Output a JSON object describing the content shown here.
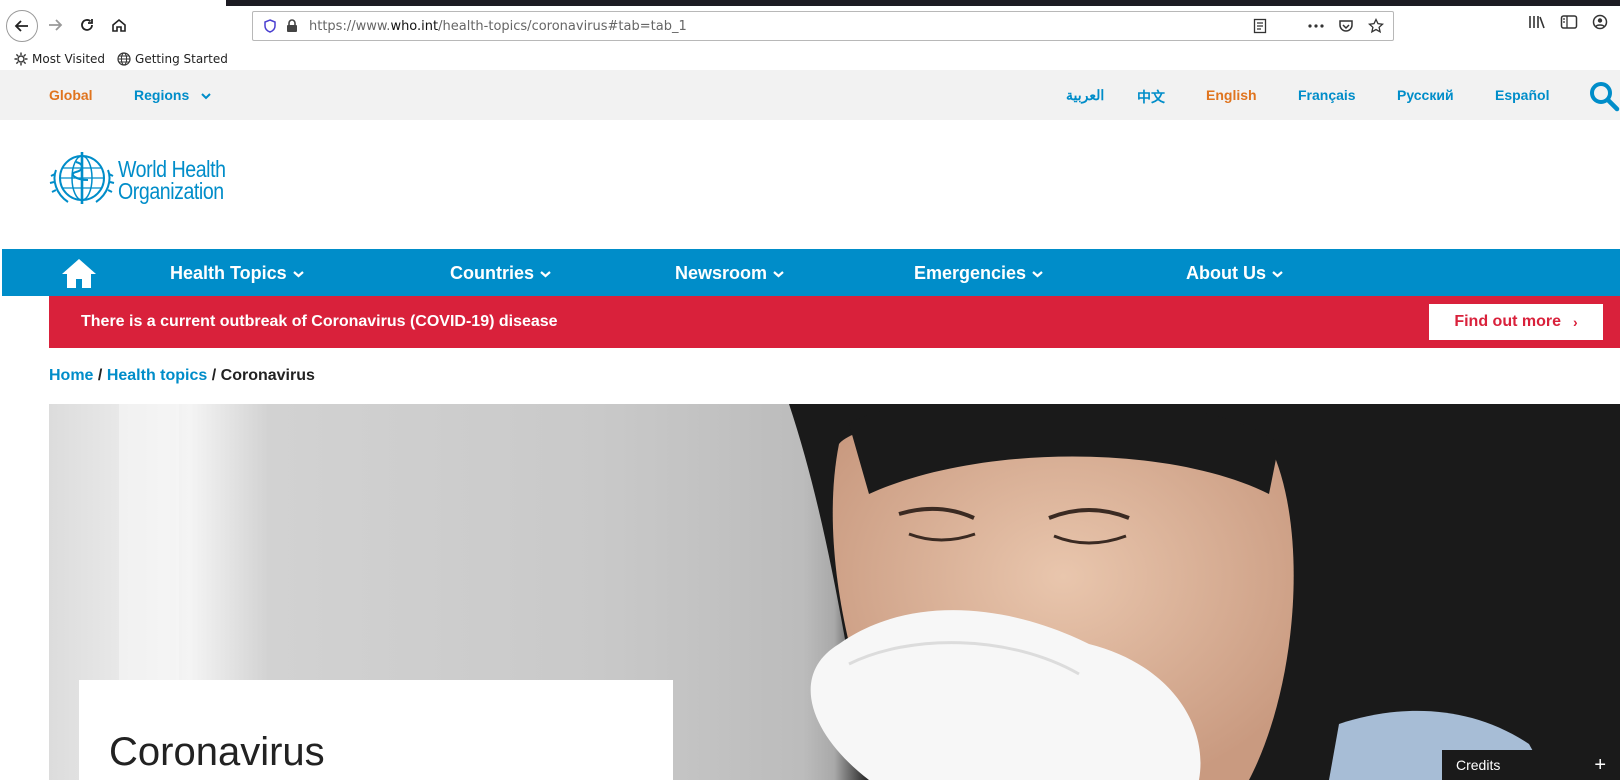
{
  "browser": {
    "url_prefix": "https://www.",
    "url_domain": "who.int",
    "url_path": "/health-topics/coronavirus#tab=tab_1",
    "bookmarks": [
      {
        "label": "Most Visited",
        "icon": "gear-icon"
      },
      {
        "label": "Getting Started",
        "icon": "globe-icon"
      }
    ]
  },
  "lang_bar": {
    "global": "Global",
    "regions": "Regions",
    "languages": [
      "العربية",
      "中文",
      "English",
      "Français",
      "Русский",
      "Español"
    ],
    "active_language": "English"
  },
  "logo": {
    "line1": "World Health",
    "line2": "Organization"
  },
  "nav": {
    "items": [
      "Health Topics",
      "Countries",
      "Newsroom",
      "Emergencies",
      "About Us"
    ]
  },
  "alert": {
    "text": "There is a current outbreak of Coronavirus (COVID-19) disease",
    "button": "Find out more",
    "button_arrow": "›"
  },
  "breadcrumb": {
    "home": "Home",
    "sep": "/",
    "topics": "Health topics",
    "current": "Coronavirus"
  },
  "hero": {
    "title": "Coronavirus",
    "credits": "Credits",
    "credits_toggle": "+"
  },
  "colors": {
    "brand_blue": "#008dc9",
    "alert_red": "#d9213b",
    "active_orange": "#e0741e"
  }
}
